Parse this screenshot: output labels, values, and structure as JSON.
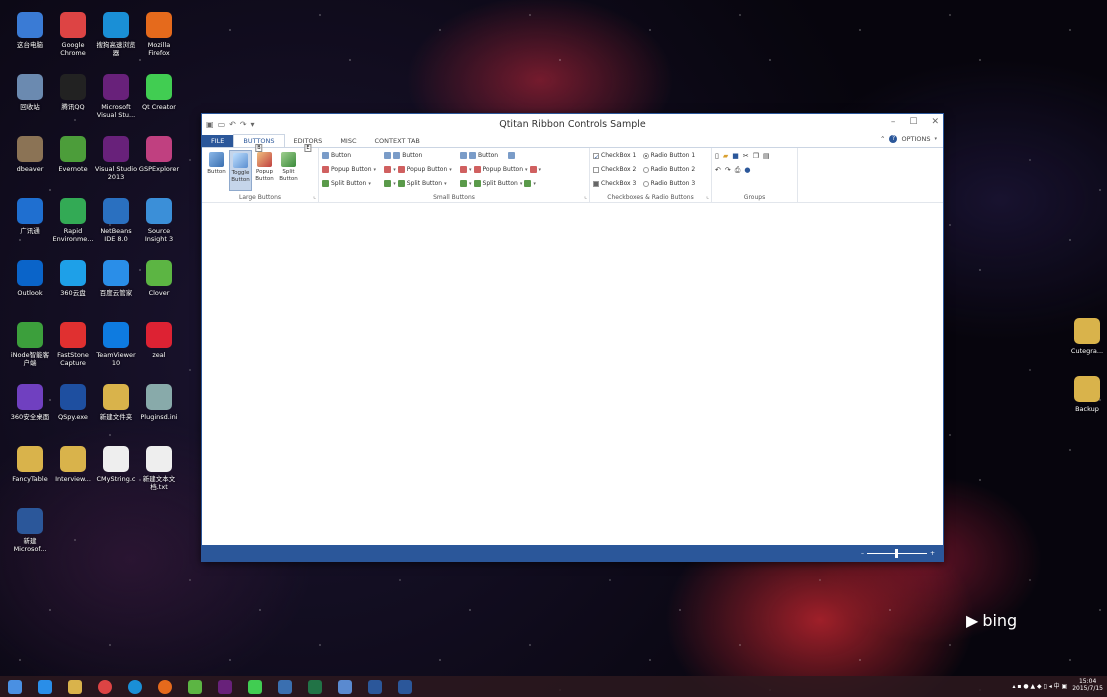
{
  "desktop_icons": [
    {
      "label": "这台电脑",
      "color": "#3a7bd5"
    },
    {
      "label": "Google Chrome",
      "color": "#d44"
    },
    {
      "label": "搜狗高速浏览器",
      "color": "#1a8fd6"
    },
    {
      "label": "Mozilla Firefox",
      "color": "#e56a1c"
    },
    {
      "label": "回收站",
      "color": "#6b8ab0"
    },
    {
      "label": "腾讯QQ",
      "color": "#222"
    },
    {
      "label": "Microsoft Visual Stu...",
      "color": "#68217a"
    },
    {
      "label": "Qt Creator",
      "color": "#41cd52"
    },
    {
      "label": "dbeaver",
      "color": "#8b7355"
    },
    {
      "label": "Evernote",
      "color": "#4c9d3a"
    },
    {
      "label": "Visual Studio 2013",
      "color": "#68217a"
    },
    {
      "label": "GSPExplorer",
      "color": "#c04080"
    },
    {
      "label": "广讯通",
      "color": "#1f6fd0"
    },
    {
      "label": "Rapid Environme...",
      "color": "#3a5"
    },
    {
      "label": "NetBeans IDE 8.0",
      "color": "#2a70c0"
    },
    {
      "label": "Source Insight 3",
      "color": "#3b8fd8"
    },
    {
      "label": "Outlook",
      "color": "#0a64c9"
    },
    {
      "label": "360云盘",
      "color": "#1ea0e8"
    },
    {
      "label": "百度云管家",
      "color": "#2a8ee8"
    },
    {
      "label": "Clover",
      "color": "#5cb543"
    },
    {
      "label": "iNode智能客户端",
      "color": "#3c9f3c"
    },
    {
      "label": "FastStone Capture",
      "color": "#e03030"
    },
    {
      "label": "TeamViewer 10",
      "color": "#0e7be0"
    },
    {
      "label": "zeal",
      "color": "#d23"
    },
    {
      "label": "360安全桌面",
      "color": "#7040c0"
    },
    {
      "label": "QSpy.exe",
      "color": "#1e4fa0"
    },
    {
      "label": "新建文件夹",
      "color": "#d9b34b"
    },
    {
      "label": "Pluginsd.ini",
      "color": "#8aa"
    },
    {
      "label": "FancyTable",
      "color": "#d9b34b"
    },
    {
      "label": "Interview...",
      "color": "#d9b34b"
    },
    {
      "label": "CMyString.c",
      "color": "#eee"
    },
    {
      "label": "新建文本文档.txt",
      "color": "#eee"
    },
    {
      "label": "新建 Microsof...",
      "color": "#2b579a"
    }
  ],
  "right_icons": [
    {
      "label": "Cutegra..."
    },
    {
      "label": "Backup"
    }
  ],
  "window": {
    "title": "Qtitan Ribbon Controls Sample",
    "tabs": {
      "file": "FILE",
      "buttons": "BUTTONS",
      "editors": "EDITORS",
      "misc": "MISC",
      "context": "CONTEXT TAB"
    },
    "keytips": {
      "b": "B",
      "e": "E"
    },
    "options": "OPTIONS",
    "large_buttons": {
      "button": "Button",
      "toggle": "Toggle Button",
      "popup": "Popup Button",
      "split": "Split Button",
      "label": "Large Buttons"
    },
    "small_buttons": {
      "label": "Small Buttons",
      "button": "Button",
      "popup": "Popup Button",
      "split": "Split Button"
    },
    "checkboxes": {
      "label": "Checkboxes & Radio Buttons",
      "cb1": "CheckBox 1",
      "cb2": "CheckBox 2",
      "cb3": "CheckBox 3",
      "rb1": "Radio Button 1",
      "rb2": "Radio Button 2",
      "rb3": "Radio Button 3"
    },
    "groups": {
      "label": "Groups"
    }
  },
  "bing": "bing",
  "clock": {
    "time": "15:04",
    "date": "2015/7/15"
  }
}
